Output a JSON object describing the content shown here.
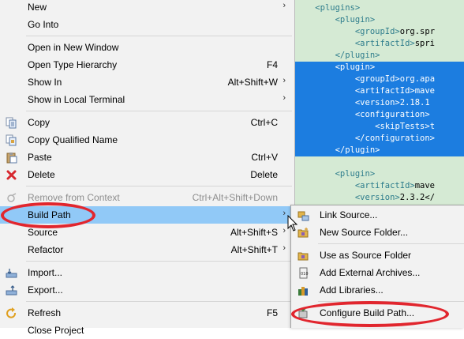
{
  "editor": {
    "lines": [
      {
        "indent": "    ",
        "text": "<plugins>",
        "val": "",
        "selected": false
      },
      {
        "indent": "        ",
        "text": "<plugin>",
        "val": "",
        "selected": false
      },
      {
        "indent": "            ",
        "text": "<groupId>",
        "val": "org.spr",
        "selected": false
      },
      {
        "indent": "            ",
        "text": "<artifactId>",
        "val": "spri",
        "selected": false
      },
      {
        "indent": "        ",
        "text": "</plugin>",
        "val": "",
        "selected": false
      },
      {
        "indent": "        ",
        "text": "<plugin>",
        "val": "",
        "selected": true
      },
      {
        "indent": "            ",
        "text": "<groupId>",
        "val": "org.apa",
        "selected": true
      },
      {
        "indent": "            ",
        "text": "<artifactId>",
        "val": "mave",
        "selected": true
      },
      {
        "indent": "            ",
        "text": "<version>",
        "val": "2.18.1",
        "selected": true
      },
      {
        "indent": "            ",
        "text": "<configuration>",
        "val": "",
        "selected": true
      },
      {
        "indent": "                ",
        "text": "<skipTests>",
        "val": "t",
        "selected": true
      },
      {
        "indent": "            ",
        "text": "</configuration>",
        "val": "",
        "selected": true
      },
      {
        "indent": "        ",
        "text": "</plugin>",
        "val": "",
        "selected": true
      },
      {
        "indent": "",
        "text": "",
        "val": "",
        "selected": false
      },
      {
        "indent": "        ",
        "text": "<plugin>",
        "val": "",
        "selected": false
      },
      {
        "indent": "            ",
        "text": "<artifactId>",
        "val": "mave",
        "selected": false
      },
      {
        "indent": "            ",
        "text": "<version>",
        "val": "2.3.2</",
        "selected": false
      }
    ]
  },
  "menu": {
    "new": {
      "label": "New"
    },
    "go_into": {
      "label": "Go Into"
    },
    "open_new_window": {
      "label": "Open in New Window"
    },
    "open_type_hierarchy": {
      "label": "Open Type Hierarchy",
      "shortcut": "F4"
    },
    "show_in": {
      "label": "Show In",
      "shortcut": "Alt+Shift+W"
    },
    "show_local_terminal": {
      "label": "Show in Local Terminal"
    },
    "copy": {
      "label": "Copy",
      "shortcut": "Ctrl+C"
    },
    "copy_qualified_name": {
      "label": "Copy Qualified Name"
    },
    "paste": {
      "label": "Paste",
      "shortcut": "Ctrl+V"
    },
    "delete": {
      "label": "Delete",
      "shortcut": "Delete"
    },
    "remove_from_context": {
      "label": "Remove from Context",
      "shortcut": "Ctrl+Alt+Shift+Down"
    },
    "build_path": {
      "label": "Build Path"
    },
    "source": {
      "label": "Source",
      "shortcut": "Alt+Shift+S"
    },
    "refactor": {
      "label": "Refactor",
      "shortcut": "Alt+Shift+T"
    },
    "import": {
      "label": "Import..."
    },
    "export": {
      "label": "Export..."
    },
    "refresh": {
      "label": "Refresh",
      "shortcut": "F5"
    },
    "close_project": {
      "label": "Close Project"
    }
  },
  "submenu": {
    "link_source": {
      "label": "Link Source..."
    },
    "new_source_folder": {
      "label": "New Source Folder..."
    },
    "use_as_source_folder": {
      "label": "Use as Source Folder"
    },
    "add_external_archives": {
      "label": "Add External Archives..."
    },
    "add_libraries": {
      "label": "Add Libraries..."
    },
    "configure_build_path": {
      "label": "Configure Build Path..."
    }
  },
  "colors": {
    "highlight": "#91c9f7",
    "selection": "#1c7de0",
    "annotation": "#e1262e",
    "editor_bg": "#d5ead4"
  }
}
